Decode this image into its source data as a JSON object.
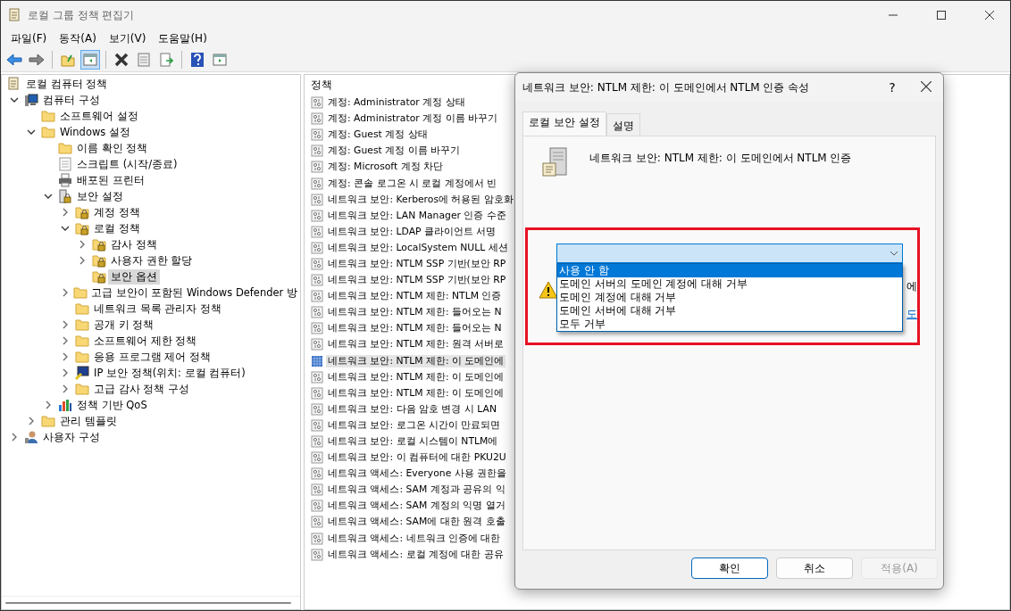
{
  "window": {
    "title": "로컬 그룹 정책 편집기"
  },
  "menu": [
    "파일(F)",
    "동작(A)",
    "보기(V)",
    "도움말(H)"
  ],
  "toolbar": [
    {
      "buttons": [
        {
          "kind": "back",
          "selected": false
        },
        {
          "kind": "forward",
          "selected": false
        }
      ]
    },
    {
      "buttons": [
        {
          "kind": "up",
          "selected": false
        },
        {
          "kind": "panel",
          "selected": true
        }
      ]
    },
    {
      "buttons": [
        {
          "kind": "delete",
          "selected": false
        },
        {
          "kind": "properties",
          "selected": false
        },
        {
          "kind": "export",
          "selected": false
        }
      ]
    },
    {
      "buttons": [
        {
          "kind": "help",
          "selected": false
        },
        {
          "kind": "view",
          "selected": false
        }
      ]
    }
  ],
  "tree": {
    "label": "로컬 컴퓨터 정책",
    "kind": "scroll",
    "children": [
      {
        "label": "컴퓨터 구성",
        "kind": "computer",
        "expanded": true,
        "selected": false,
        "children": [
          {
            "label": "소프트웨어 설정",
            "kind": "folder",
            "selected": false
          },
          {
            "label": "Windows 설정",
            "kind": "folder",
            "expanded": true,
            "selected": false,
            "children": [
              {
                "label": "이름 확인 정책",
                "kind": "folder",
                "selected": false
              },
              {
                "label": "스크립트 (시작/종료)",
                "kind": "script",
                "selected": false
              },
              {
                "label": "배포된 프린터",
                "kind": "printer",
                "selected": false
              },
              {
                "label": "보안 설정",
                "kind": "lockserver",
                "expanded": true,
                "selected": false,
                "children": [
                  {
                    "label": "계정 정책",
                    "kind": "lockfolder",
                    "expanded": false,
                    "selected": false
                  },
                  {
                    "label": "로컬 정책",
                    "kind": "lockfolder",
                    "expanded": true,
                    "selected": false,
                    "children": [
                      {
                        "label": "감사 정책",
                        "kind": "lockfolder",
                        "expanded": false,
                        "selected": false
                      },
                      {
                        "label": "사용자 권한 할당",
                        "kind": "lockfolder",
                        "expanded": false,
                        "selected": false
                      },
                      {
                        "label": "보안 옵션",
                        "kind": "lockfolder",
                        "selected": true
                      }
                    ]
                  },
                  {
                    "label": "고급 보안이 포함된 Windows Defender 방",
                    "kind": "folder",
                    "expanded": false,
                    "selected": false
                  },
                  {
                    "label": "네트워크 목록 관리자 정책",
                    "kind": "folder",
                    "selected": false
                  },
                  {
                    "label": "공개 키 정책",
                    "kind": "folder",
                    "expanded": false,
                    "selected": false
                  },
                  {
                    "label": "소프트웨어 제한 정책",
                    "kind": "folder",
                    "expanded": false,
                    "selected": false
                  },
                  {
                    "label": "응용 프로그램 제어 정책",
                    "kind": "folder",
                    "expanded": false,
                    "selected": false
                  },
                  {
                    "label": "IP 보안 정책(위치: 로컬 컴퓨터)",
                    "kind": "ipsec",
                    "expanded": false,
                    "selected": false
                  },
                  {
                    "label": "고급 감사 정책 구성",
                    "kind": "folder",
                    "expanded": false,
                    "selected": false
                  }
                ]
              },
              {
                "label": "정책 기반 QoS",
                "kind": "chart",
                "expanded": false,
                "selected": false
              }
            ]
          },
          {
            "label": "관리 템플릿",
            "kind": "folder",
            "expanded": false,
            "selected": false
          }
        ]
      },
      {
        "label": "사용자 구성",
        "kind": "user",
        "expanded": false,
        "selected": false
      }
    ]
  },
  "policy_list": {
    "header": "정책",
    "items": [
      {
        "label": "계정: Administrator 계정 상태",
        "selected": false
      },
      {
        "label": "계정: Administrator 계정 이름 바꾸기",
        "selected": false
      },
      {
        "label": "계정: Guest 계정 상태",
        "selected": false
      },
      {
        "label": "계정: Guest 계정 이름 바꾸기",
        "selected": false
      },
      {
        "label": "계정: Microsoft 계정 차단",
        "selected": false
      },
      {
        "label": "계정: 콘솔 로그온 시 로컬 계정에서 빈",
        "selected": false
      },
      {
        "label": "네트워크 보안: Kerberos에 허용된 암호화",
        "selected": false
      },
      {
        "label": "네트워크 보안: LAN Manager 인증 수준",
        "selected": false
      },
      {
        "label": "네트워크 보안: LDAP 클라이언트 서명",
        "selected": false
      },
      {
        "label": "네트워크 보안: LocalSystem NULL 세션",
        "selected": false
      },
      {
        "label": "네트워크 보안: NTLM SSP 기반(보안 RP",
        "selected": false
      },
      {
        "label": "네트워크 보안: NTLM SSP 기반(보안 RP",
        "selected": false
      },
      {
        "label": "네트워크 보안: NTLM 제한: NTLM 인증",
        "selected": false
      },
      {
        "label": "네트워크 보안: NTLM 제한: 들어오는 N",
        "selected": false
      },
      {
        "label": "네트워크 보안: NTLM 제한: 들어오는 N",
        "selected": false
      },
      {
        "label": "네트워크 보안: NTLM 제한: 원격 서버로",
        "selected": false
      },
      {
        "label": "네트워크 보안: NTLM 제한: 이 도메인에",
        "selected": true
      },
      {
        "label": "네트워크 보안: NTLM 제한: 이 도메인에",
        "selected": false
      },
      {
        "label": "네트워크 보안: NTLM 제한: 이 도메인에",
        "selected": false
      },
      {
        "label": "네트워크 보안: 다음 암호 변경 시 LAN",
        "selected": false
      },
      {
        "label": "네트워크 보안: 로그온 시간이 만료되면",
        "selected": false
      },
      {
        "label": "네트워크 보안: 로컬 시스템이 NTLM에",
        "selected": false
      },
      {
        "label": "네트워크 보안: 이 컴퓨터에 대한 PKU2U",
        "selected": false
      },
      {
        "label": "네트워크 액세스: Everyone 사용 권한을",
        "selected": false
      },
      {
        "label": "네트워크 액세스: SAM 계정과 공유의 익",
        "selected": false
      },
      {
        "label": "네트워크 액세스: SAM 계정의 익명 열거",
        "selected": false
      },
      {
        "label": "네트워크 액세스: SAM에 대한 원격 호출",
        "selected": false
      },
      {
        "label": "네트워크 액세스: 네트워크 인증에 대한",
        "selected": false
      },
      {
        "label": "네트워크 액세스: 로컬 계정에 대한 공유",
        "selected": false
      }
    ]
  },
  "dialog": {
    "title": "네트워크 보안: NTLM 제한: 이 도메인에서 NTLM 인증 속성",
    "help": "?",
    "tabs": [
      {
        "label": "로컬 보안 설정",
        "selected": true
      },
      {
        "label": "설명",
        "selected": false
      }
    ],
    "heading": "네트워크 보안: NTLM 제한: 이 도메인에서 NTLM 인증",
    "dropdown": {
      "expanded": true,
      "options": [
        {
          "label": "사용 안 함",
          "selected": true
        },
        {
          "label": "도메인 서버의 도메인 계정에 대해 거부",
          "selected": false
        },
        {
          "label": "도메인 계정에 대해 거부",
          "selected": false
        },
        {
          "label": "도메인 서버에 대해 거부",
          "selected": false
        },
        {
          "label": "모두 거부",
          "selected": false
        }
      ]
    },
    "warning_text": "에",
    "link_text": "도",
    "buttons": [
      {
        "label": "확인",
        "focused": true,
        "disabled": false
      },
      {
        "label": "취소",
        "focused": false,
        "disabled": false
      },
      {
        "label": "적용(A)",
        "focused": false,
        "disabled": true
      }
    ]
  }
}
